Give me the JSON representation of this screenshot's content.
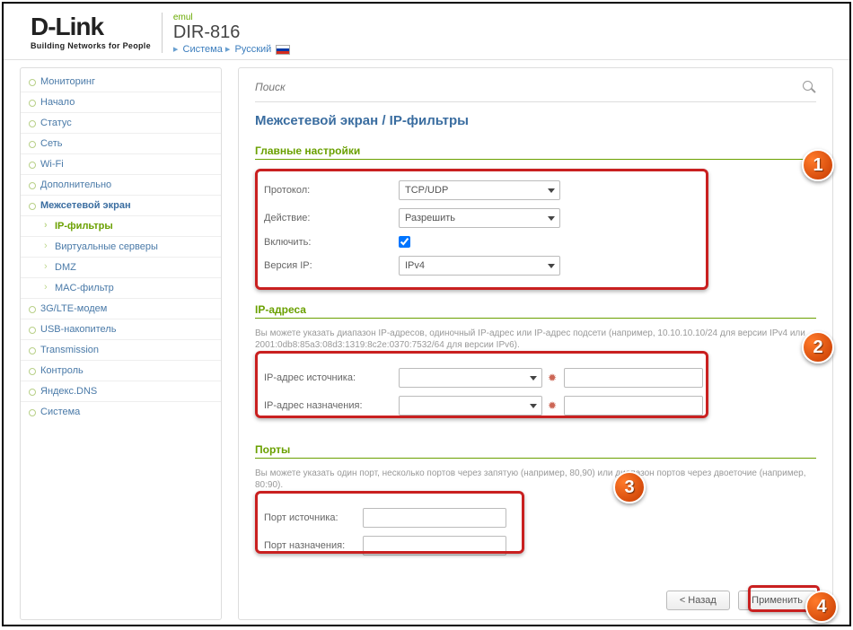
{
  "header": {
    "brand": "D-Link",
    "tag": "Building Networks for People",
    "emul": "emul",
    "model": "DIR-816",
    "crumb_system": "Система",
    "crumb_lang": "Русский"
  },
  "nav": {
    "monitoring": "Мониторинг",
    "start": "Начало",
    "status": "Статус",
    "net": "Сеть",
    "wifi": "Wi-Fi",
    "extra": "Дополнительно",
    "firewall": "Межсетевой экран",
    "ip_filters": "IP-фильтры",
    "virtual": "Виртуальные серверы",
    "dmz": "DMZ",
    "mac": "MAC-фильтр",
    "lte": "3G/LTE-модем",
    "usb": "USB-накопитель",
    "trans": "Transmission",
    "control": "Контроль",
    "ydns": "Яндекс.DNS",
    "system": "Система"
  },
  "search": {
    "placeholder": "Поиск"
  },
  "page": {
    "title": "Межсетевой экран /  IP-фильтры"
  },
  "sections": {
    "main": {
      "title": "Главные настройки",
      "protocol_label": "Протокол:",
      "protocol_value": "TCP/UDP",
      "action_label": "Действие:",
      "action_value": "Разрешить",
      "enable_label": "Включить:",
      "ipver_label": "Версия IP:",
      "ipver_value": "IPv4"
    },
    "ips": {
      "title": "IP-адреса",
      "help": "Вы можете указать диапазон IP-адресов, одиночный IP-адрес или IP-адрес подсети (например, 10.10.10.10/24 для версии IPv4 или 2001:0db8:85a3:08d3:1319:8c2e:0370:7532/64 для версии IPv6).",
      "src_label": "IP-адрес источника:",
      "dst_label": "IP-адрес назначения:"
    },
    "ports": {
      "title": "Порты",
      "help": "Вы можете указать один порт, несколько портов через запятую (например, 80,90) или диапазон портов через двоеточие (например, 80:90).",
      "src_label": "Порт источника:",
      "dst_label": "Порт назначения:"
    }
  },
  "buttons": {
    "back": "< Назад",
    "apply": "Применить"
  },
  "bubbles": {
    "b1": "1",
    "b2": "2",
    "b3": "3",
    "b4": "4"
  }
}
